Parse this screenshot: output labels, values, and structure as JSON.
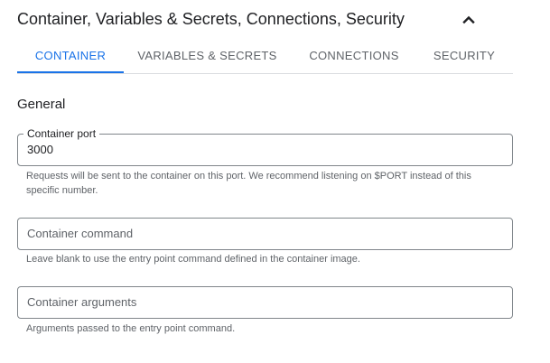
{
  "header": {
    "title": "Container, Variables & Secrets, Connections, Security",
    "collapse_icon": "chevron-up-icon"
  },
  "tabs": [
    {
      "label": "CONTAINER",
      "active": true
    },
    {
      "label": "VARIABLES & SECRETS",
      "active": false
    },
    {
      "label": "CONNECTIONS",
      "active": false
    },
    {
      "label": "SECURITY",
      "active": false
    }
  ],
  "colors": {
    "accent": "#1a73e8",
    "text_primary": "#202124",
    "text_secondary": "#5f6368",
    "border": "#80868b",
    "divider": "#dadce0"
  },
  "general": {
    "title": "General",
    "container_port": {
      "label": "Container port",
      "value": "3000",
      "hint": "Requests will be sent to the container on this port. We recommend listening on $PORT instead of this specific number."
    },
    "container_command": {
      "placeholder": "Container command",
      "value": "",
      "hint": "Leave blank to use the entry point command defined in the container image."
    },
    "container_arguments": {
      "placeholder": "Container arguments",
      "value": "",
      "hint": "Arguments passed to the entry point command."
    }
  }
}
